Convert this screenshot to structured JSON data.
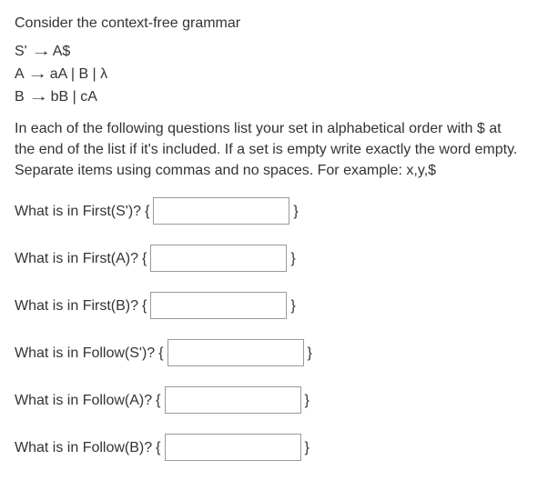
{
  "intro": "Consider the context-free grammar",
  "grammar": {
    "line1_lhs": "S'",
    "line1_rhs": "A$",
    "line2_lhs": "A",
    "line2_rhs": "aA | B | λ",
    "line3_lhs": "B",
    "line3_rhs": "bB | cA",
    "arrow": "→"
  },
  "instructions": "In each of the following questions list your set in alphabetical order with $ at the end of the list if it's included. If a set is empty write exactly the word empty. Separate items using commas and no spaces. For example: x,y,$",
  "questions": [
    {
      "label": "What is in First(S')?",
      "open": "{",
      "close": "}"
    },
    {
      "label": "What is in First(A)?",
      "open": "{",
      "close": "}"
    },
    {
      "label": "What is in First(B)?",
      "open": "{",
      "close": "}"
    },
    {
      "label": "What is in Follow(S')?",
      "open": "{",
      "close": "}"
    },
    {
      "label": "What is in Follow(A)?",
      "open": "{",
      "close": "}"
    },
    {
      "label": "What is in Follow(B)?",
      "open": "{",
      "close": "}"
    }
  ]
}
